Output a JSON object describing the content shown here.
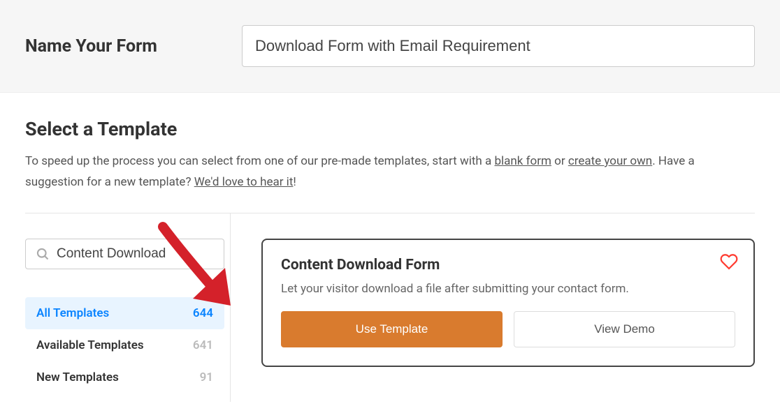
{
  "header": {
    "label": "Name Your Form",
    "form_name_value": "Download Form with Email Requirement"
  },
  "section": {
    "title": "Select a Template",
    "desc_prefix": "To speed up the process you can select from one of our pre-made templates, start with a ",
    "link_blank": "blank form",
    "desc_mid1": " or ",
    "link_create": "create your own",
    "desc_mid2": ". Have a suggestion for a new template? ",
    "link_hear": "We'd love to hear it",
    "desc_suffix": "!"
  },
  "search": {
    "value": "Content Download"
  },
  "categories": [
    {
      "label": "All Templates",
      "count": "644",
      "active": true
    },
    {
      "label": "Available Templates",
      "count": "641",
      "active": false
    },
    {
      "label": "New Templates",
      "count": "91",
      "active": false
    }
  ],
  "card": {
    "title": "Content Download Form",
    "description": "Let your visitor download a file after submitting your contact form.",
    "primary_btn": "Use Template",
    "secondary_btn": "View Demo"
  }
}
